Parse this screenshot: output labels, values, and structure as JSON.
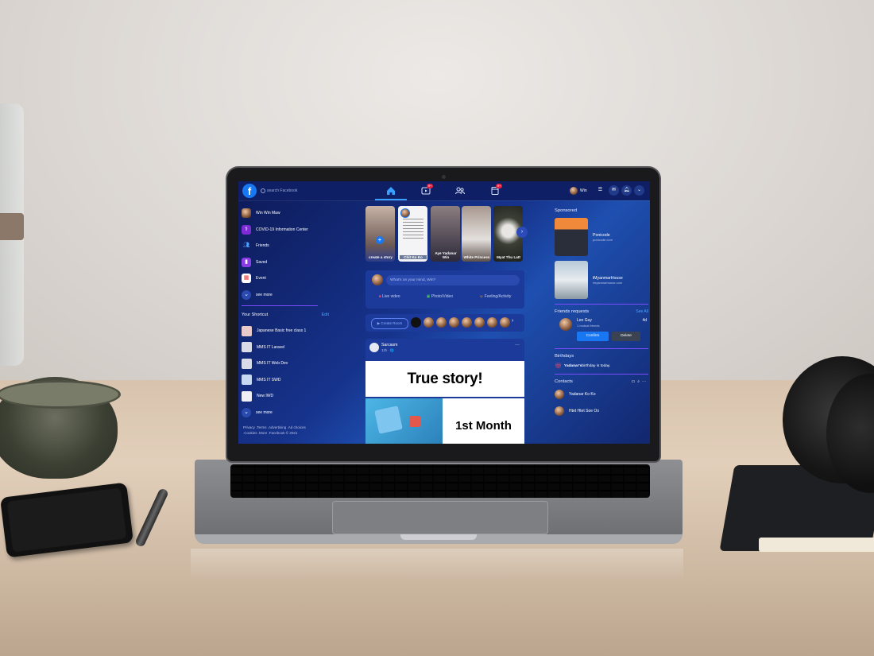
{
  "topbar": {
    "search_placeholder": "search Facebook",
    "logo": "f",
    "notifications": {
      "video_badge": "9+",
      "pages_badge": "9+"
    },
    "user_name": "Win"
  },
  "left_nav": {
    "items": [
      {
        "label": "Win Win Maw",
        "icon": "profile-avatar"
      },
      {
        "label": "COVID-19 Information Center",
        "icon": "covid-icon"
      },
      {
        "label": "Friends",
        "icon": "friends-icon"
      },
      {
        "label": "Saved",
        "icon": "bookmark-icon"
      },
      {
        "label": "Event",
        "icon": "calendar-icon"
      },
      {
        "label": "see more",
        "icon": "chevron-down-icon"
      }
    ],
    "shortcut_title": "Your Shortcut",
    "edit_label": "Edit",
    "shortcuts": [
      {
        "label": "Japanese Basic free class 1"
      },
      {
        "label": "MMS IT Laravel"
      },
      {
        "label": "MMS IT Web Dev"
      },
      {
        "label": "MMS IT SWD"
      },
      {
        "label": "New IWD"
      },
      {
        "label": "see more"
      }
    ],
    "footer": "Privacy .Terms .Advertising .Ad choices .Cookies .More .Facebook © 2021"
  },
  "stories": [
    {
      "label": "create a story"
    },
    {
      "label": "Chit Ko Ko"
    },
    {
      "label": "Aye Yadanar Win"
    },
    {
      "label": "White Princess"
    },
    {
      "label": "Myat Thu Latt"
    }
  ],
  "composer": {
    "placeholder": "What's on your mind, Win?",
    "actions": [
      "Live video",
      "Photo/Video",
      "Feeling/Activity"
    ]
  },
  "rooms": {
    "create_label": "Create Room"
  },
  "post": {
    "author": "Sarcasm",
    "time": "12h · 🌐",
    "image_text_1": "True story!",
    "image_text_2": "1st Month"
  },
  "right_panel": {
    "sponsored_title": "Sponsored",
    "ads": [
      {
        "name": "Ponicode",
        "url": "ponicode.com"
      },
      {
        "name": "iMyanmarHouse",
        "url": "imyanmarhouse.com"
      }
    ],
    "friend_requests_title": "Friends requests",
    "see_all": "See All",
    "request": {
      "name": "Leo Guy",
      "mutual": "1 mutual friends",
      "time": "4d",
      "confirm": "Confirm",
      "delete": "Delete"
    },
    "birthdays_title": "Birthdays",
    "birthday_name": "Yadanar's",
    "birthday_text": " birthday is today.",
    "contacts_title": "Contacts",
    "contacts": [
      "Yadanar Ko Ko",
      "Htet Htet Soe Oo"
    ]
  },
  "colors": {
    "accent": "#1877f2",
    "screen_bg": "#16338c",
    "divider": "#7b4cff"
  }
}
